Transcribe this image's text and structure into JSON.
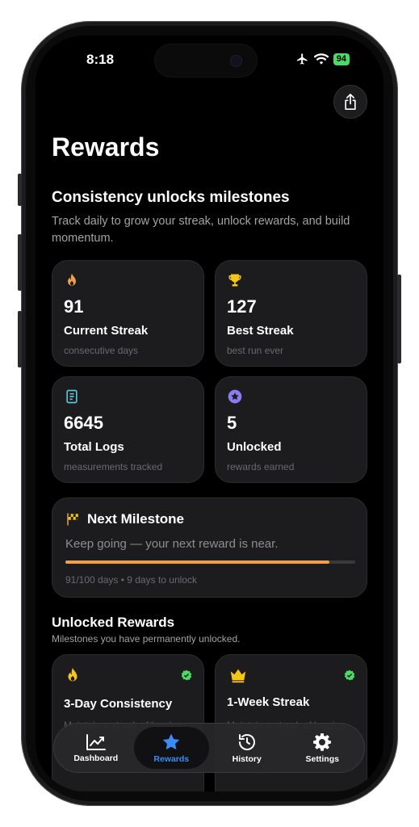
{
  "status": {
    "time": "8:18",
    "battery": "94"
  },
  "page": {
    "title": "Rewards"
  },
  "intro": {
    "heading": "Consistency unlocks milestones",
    "subtitle": "Track daily to grow your streak, unlock rewards, and build momentum."
  },
  "stats": [
    {
      "icon": "flame-icon",
      "value": "91",
      "label": "Current Streak",
      "caption": "consecutive days",
      "color": "#f0a04b"
    },
    {
      "icon": "trophy-icon",
      "value": "127",
      "label": "Best Streak",
      "caption": "best run ever",
      "color": "#f5c518"
    },
    {
      "icon": "notebook-icon",
      "value": "6645",
      "label": "Total Logs",
      "caption": "measurements tracked",
      "color": "#59c4d4"
    },
    {
      "icon": "star-badge-icon",
      "value": "5",
      "label": "Unlocked",
      "caption": "rewards earned",
      "color": "#8a7cf5"
    }
  ],
  "milestone": {
    "title": "Next Milestone",
    "message": "Keep going — your next reward is near.",
    "progress": 0.91,
    "caption": "91/100 days • 9 days to unlock"
  },
  "unlocked": {
    "title": "Unlocked Rewards",
    "subtitle": "Milestones you have permanently unlocked.",
    "items": [
      {
        "icon": "flame-icon",
        "title": "3-Day Consistency",
        "description": "Maintain a streak of logging",
        "color": "#f5c518"
      },
      {
        "icon": "crown-icon",
        "title": "1-Week Streak",
        "description": "Maintain a streak of logging",
        "color": "#f5c518"
      }
    ]
  },
  "tabs": [
    {
      "icon": "chart-icon",
      "label": "Dashboard",
      "active": false
    },
    {
      "icon": "star-icon",
      "label": "Rewards",
      "active": true
    },
    {
      "icon": "history-icon",
      "label": "History",
      "active": false
    },
    {
      "icon": "gear-icon",
      "label": "Settings",
      "active": false
    }
  ],
  "colors": {
    "accent": "#3a8df5",
    "progress": "#f0a04b",
    "check": "#4cd964"
  }
}
